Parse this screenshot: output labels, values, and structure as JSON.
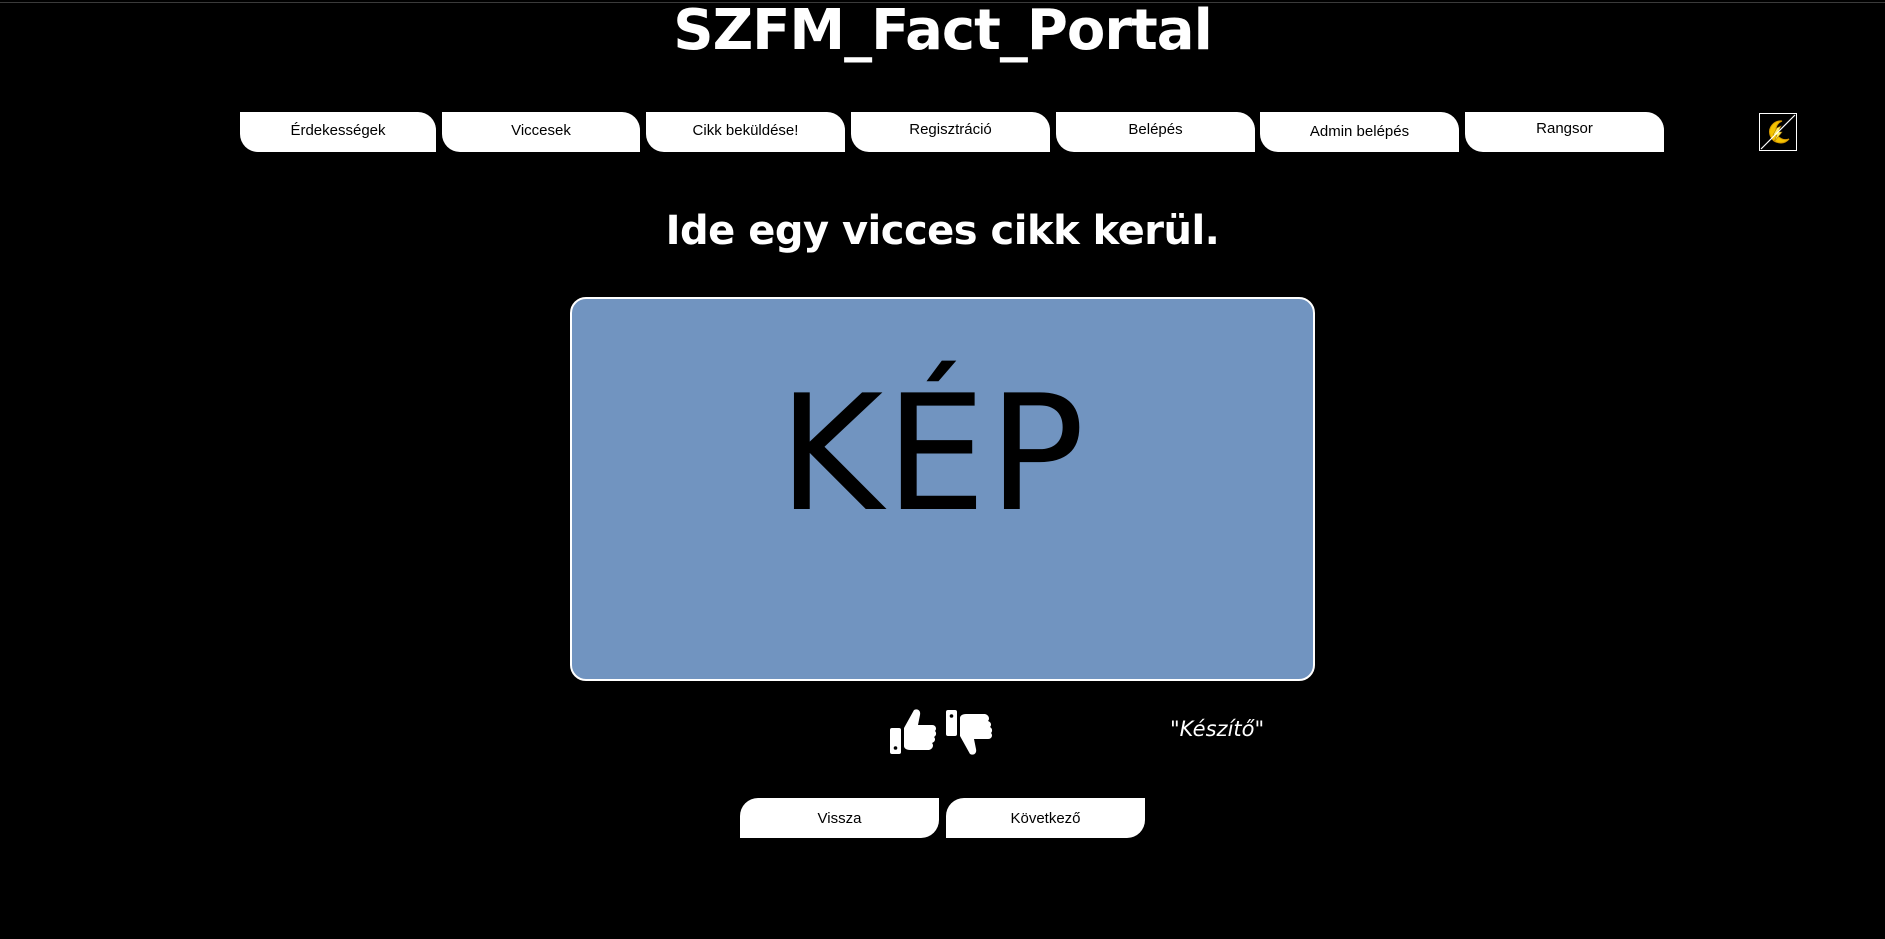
{
  "site": {
    "title": "SZFM_Fact_Portal"
  },
  "nav": {
    "items": [
      {
        "label": "Érdekességek"
      },
      {
        "label": "Viccesek"
      },
      {
        "label": "Cikk beküldése!"
      },
      {
        "label": "Regisztráció"
      },
      {
        "label": "Belépés"
      },
      {
        "label": "Admin belépés"
      },
      {
        "label": "Rangsor"
      }
    ],
    "theme_toggle_icon": "dark-mode-toggle-icon"
  },
  "article": {
    "heading": "Ide egy vicces cikk kerül.",
    "image_placeholder": "KÉP",
    "author": "\"Készítő\"",
    "icons": {
      "like": "thumbs-up-icon",
      "dislike": "thumbs-down-icon"
    }
  },
  "pager": {
    "back_label": "Vissza",
    "next_label": "Következő"
  },
  "colors": {
    "background": "#000000",
    "image_placeholder": "#7194c0",
    "button": "#ffffff"
  }
}
